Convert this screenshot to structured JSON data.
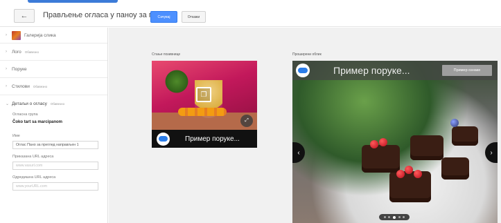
{
  "header": {
    "back_icon": "arrow-left-icon",
    "title": "Прављење огласа у паноу за преглед",
    "save_label": "Сачувај",
    "cancel_label": "Откажи"
  },
  "sidebar": {
    "gallery": {
      "label": "Галерија слика"
    },
    "sections": [
      {
        "label": "Лого",
        "edit": "Обавезно"
      },
      {
        "label": "Поруке",
        "edit": ""
      },
      {
        "label": "Стилови",
        "edit": "Обавезно"
      }
    ],
    "details": {
      "label": "Детаљи о огласу",
      "edit": "Обавезно",
      "group_label": "Огласна група",
      "group_value": "Čoko tart sa marcipanom",
      "name_label": "Име",
      "name_value": "Оглас Пано за преглед направљен 1",
      "display_url_label": "Приказана URL адреса",
      "display_url_placeholder": "www.vasurl.com",
      "dest_url_label": "Одредишна URL адреса",
      "dest_url_placeholder": "www.yourURL.com"
    }
  },
  "main": {
    "collapsed_label": "Стање позивнице",
    "expanded_label": "Проширени облик",
    "collapsed_message": "Пример поруке...",
    "expanded_message": "Пример поруке...",
    "example_button": "Пример ознаке",
    "carousel_dots": 5,
    "carousel_active": 3
  }
}
